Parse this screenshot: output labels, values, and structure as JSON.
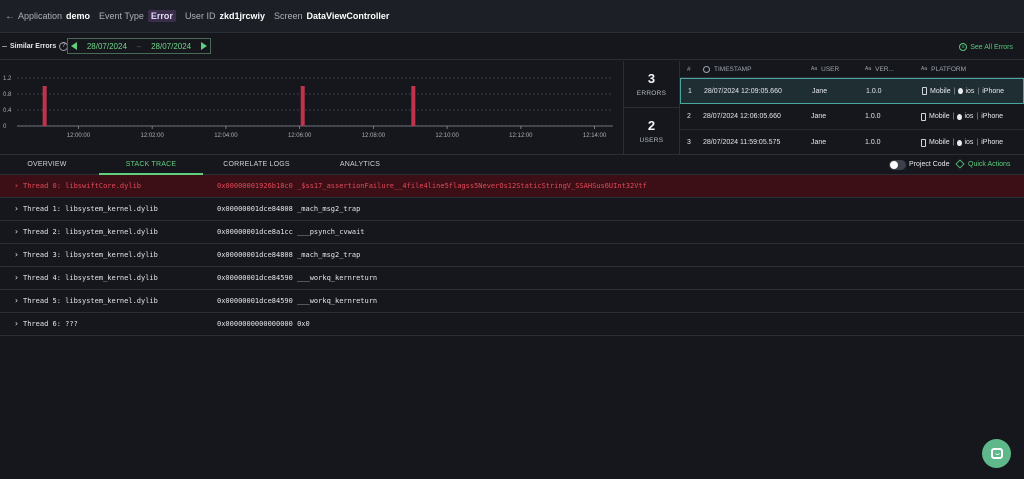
{
  "header": {
    "application_label": "Application",
    "application_value": "demo",
    "event_type_label": "Event Type",
    "event_type_value": "Error",
    "user_id_label": "User ID",
    "user_id_value": "zkd1jrcwiy",
    "screen_label": "Screen",
    "screen_value": "DataViewController"
  },
  "similar": {
    "title": "Similar Errors",
    "date_from": "28/07/2024",
    "date_to": "28/07/2024",
    "see_all": "See All Errors"
  },
  "chart_data": {
    "type": "bar",
    "title": "",
    "xlabel": "",
    "ylabel": "",
    "ylim": [
      0,
      1.2
    ],
    "y_ticks": [
      "1.2",
      "0.8",
      "0.4",
      "0"
    ],
    "x_ticks": [
      "12:00:00",
      "12:02:00",
      "12:04:00",
      "12:06:00",
      "12:08:00",
      "12:10:00",
      "12:12:00",
      "12:14:00"
    ],
    "x_min": "11:58:20",
    "x_max": "12:14:30",
    "points": [
      {
        "x": "11:59:05",
        "value": 1
      },
      {
        "x": "12:06:05",
        "value": 1
      },
      {
        "x": "12:09:05",
        "value": 1
      }
    ],
    "bar_color": "#c0334d",
    "grid": true
  },
  "stats": {
    "errors_count": "3",
    "errors_label": "ERRORS",
    "users_count": "2",
    "users_label": "USERS"
  },
  "occurrences": {
    "headers": {
      "num": "#",
      "timestamp": "TIMESTAMP",
      "user": "USER",
      "version": "VER...",
      "platform": "PLATFORM"
    },
    "rows": [
      {
        "num": "1",
        "timestamp": "28/07/2024 12:09:05.660",
        "user": "Jane",
        "version": "1.0.0",
        "device": "Mobile",
        "os": "ios",
        "model": "iPhone"
      },
      {
        "num": "2",
        "timestamp": "28/07/2024 12:06:05.660",
        "user": "Jane",
        "version": "1.0.0",
        "device": "Mobile",
        "os": "ios",
        "model": "iPhone"
      },
      {
        "num": "3",
        "timestamp": "28/07/2024 11:59:05.575",
        "user": "Jane",
        "version": "1.0.0",
        "device": "Mobile",
        "os": "ios",
        "model": "iPhone"
      }
    ]
  },
  "tabs": {
    "overview": "OVERVIEW",
    "stack_trace": "STACK TRACE",
    "correlate_logs": "CORRELATE LOGS",
    "analytics": "ANALYTICS",
    "project_code": "Project Code",
    "quick_actions": "Quick Actions"
  },
  "threads": [
    {
      "name": "Thread 0: libswiftCore.dylib",
      "address": "0x00000001926b18c0 _$ss17_assertionFailure__4file4line5flagss5NeverOs12StaticStringV_SSAHSus6UInt32Vtf"
    },
    {
      "name": "Thread 1: libsystem_kernel.dylib",
      "address": "0x00000001dce84808 _mach_msg2_trap"
    },
    {
      "name": "Thread 2: libsystem_kernel.dylib",
      "address": "0x00000001dce8a1cc ___psynch_cvwait"
    },
    {
      "name": "Thread 3: libsystem_kernel.dylib",
      "address": "0x00000001dce84808 _mach_msg2_trap"
    },
    {
      "name": "Thread 4: libsystem_kernel.dylib",
      "address": "0x00000001dce84590 ___workq_kernreturn"
    },
    {
      "name": "Thread 5: libsystem_kernel.dylib",
      "address": "0x00000001dce84590 ___workq_kernreturn"
    },
    {
      "name": "Thread 6: ???",
      "address": "0x0000000000000000 0x0"
    }
  ],
  "colors": {
    "accent": "#5fcf7e",
    "error": "#c0334d",
    "background": "#15171c"
  }
}
